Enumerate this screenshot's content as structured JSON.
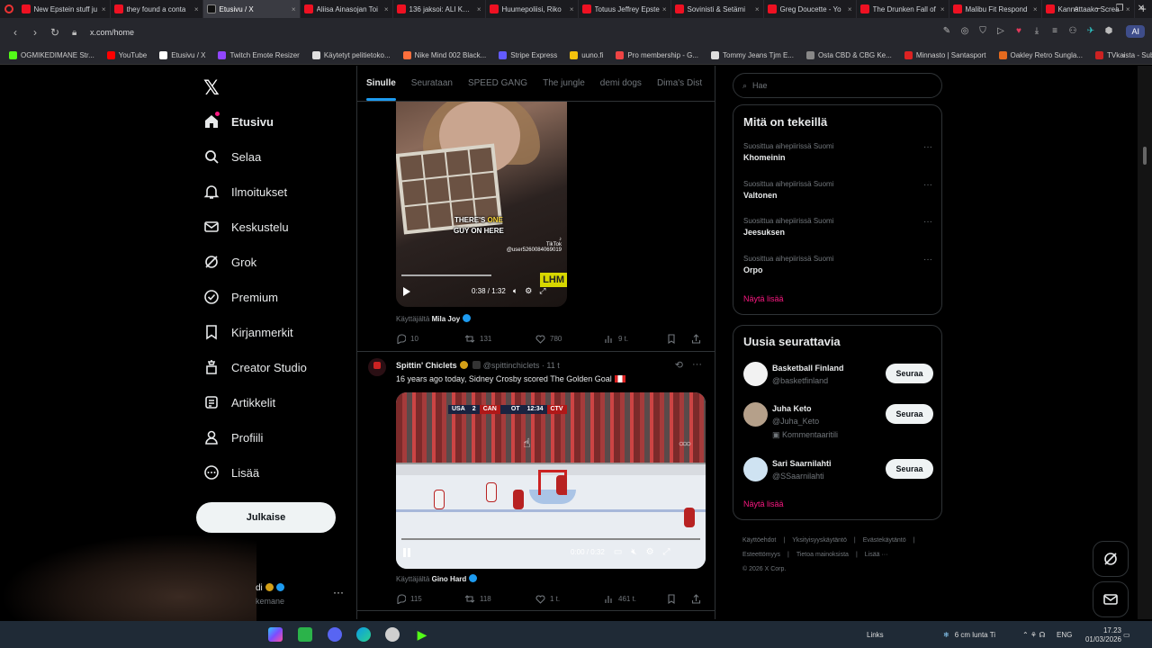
{
  "browser": {
    "tabs": [
      {
        "title": "New Epstein stuff ju",
        "favicon": "youtube-icon"
      },
      {
        "title": "they found a conta",
        "favicon": "youtube-icon"
      },
      {
        "title": "Etusivu / X",
        "favicon": "x-icon",
        "active": true
      },
      {
        "title": "Aliisa Ainasojan Toi",
        "favicon": "youtube-icon"
      },
      {
        "title": "136 jaksoi: ALI KHAN",
        "favicon": "youtube-icon"
      },
      {
        "title": "Huumepoliisi, Riko",
        "favicon": "youtube-icon"
      },
      {
        "title": "Totuus Jeffrey Epste",
        "favicon": "youtube-icon"
      },
      {
        "title": "Sovinisti & Setämi",
        "favicon": "youtube-icon"
      },
      {
        "title": "Greg Doucette - Yo",
        "favicon": "youtube-icon"
      },
      {
        "title": "The Drunken Fall of",
        "favicon": "youtube-icon"
      },
      {
        "title": "Malibu Fit Respond",
        "favicon": "youtube-icon"
      },
      {
        "title": "Kannattaako Screa",
        "favicon": "youtube-icon"
      }
    ],
    "url": "x.com/home",
    "ai_label": "AI",
    "bookmarks": [
      {
        "label": "OGMIKEDIMANE Str...",
        "color": "#53fc18"
      },
      {
        "label": "YouTube",
        "color": "#ff0000"
      },
      {
        "label": "Etusivu / X",
        "color": "#ffffff"
      },
      {
        "label": "Twitch Emote Resizer",
        "color": "#9146ff"
      },
      {
        "label": "Käytetyt pelitietoko...",
        "color": "#e0e0e0"
      },
      {
        "label": "Nike Mind 002 Black...",
        "color": "#ff6f3c"
      },
      {
        "label": "Stripe Express",
        "color": "#635bff"
      },
      {
        "label": "uuno.fi",
        "color": "#f4c20d"
      },
      {
        "label": "Pro membership - G...",
        "color": "#e44"
      },
      {
        "label": "Tommy Jeans Tjm E...",
        "color": "#ddd"
      },
      {
        "label": "Osta CBD & CBG Ke...",
        "color": "#888"
      },
      {
        "label": "Minnasto | Santasport",
        "color": "#d22"
      },
      {
        "label": "Oakley Retro Sungla...",
        "color": "#e46a1e"
      },
      {
        "label": "TVkaista - Sub Suara",
        "color": "#c22"
      }
    ]
  },
  "nav": {
    "items": [
      {
        "label": "Etusivu",
        "icon": "home-icon"
      },
      {
        "label": "Selaa",
        "icon": "search-icon"
      },
      {
        "label": "Ilmoitukset",
        "icon": "bell-icon"
      },
      {
        "label": "Keskustelu",
        "icon": "mail-icon"
      },
      {
        "label": "Grok",
        "icon": "grok-icon"
      },
      {
        "label": "Premium",
        "icon": "premium-icon"
      },
      {
        "label": "Kirjanmerkit",
        "icon": "bookmark-icon"
      },
      {
        "label": "Creator Studio",
        "icon": "creator-icon"
      },
      {
        "label": "Artikkelit",
        "icon": "article-icon"
      },
      {
        "label": "Profiili",
        "icon": "profile-icon"
      },
      {
        "label": "Lisää",
        "icon": "more-icon"
      }
    ],
    "post_button": "Julkaise",
    "account_name": "di",
    "account_handle": "kemane"
  },
  "feed": {
    "tabs": [
      "Sinulle",
      "Seurataan",
      "SPEED GANG",
      "The jungle",
      "demi dogs",
      "Dima's Dist"
    ],
    "post1": {
      "caption_line1_pre": "THERE'S ",
      "caption_line1_hl": "ONE",
      "caption_line2": "GUY ON HERE",
      "tiktok": "TikTok",
      "tiktok_user": "@user5260084069019",
      "badge": "LHM",
      "video_time": "0:38 / 1:32",
      "byline_prefix": "Käyttäjältä",
      "byline_name": "Mila Joy",
      "replies": "10",
      "reposts": "131",
      "likes": "780",
      "views": "9 t."
    },
    "post2": {
      "author": "Spittin' Chiclets",
      "handle": "@spittinchiclets",
      "time": "· 11 t",
      "text": "16 years ago today, Sidney Crosby scored The Golden Goal",
      "score_usa": "USA",
      "score_usa_val": "2",
      "score_can": "CAN",
      "score_can_val": "",
      "period": "OT",
      "clock": "12:34",
      "network": "CTV",
      "video_time": "0:00 / 0:32",
      "byline_prefix": "Käyttäjältä",
      "byline_name": "Gino Hard",
      "replies": "115",
      "reposts": "118",
      "likes": "1 t.",
      "views": "461 t."
    }
  },
  "sidebar": {
    "search_placeholder": "Hae",
    "trends_title": "Mitä on tekeillä",
    "trends": [
      {
        "context": "Suosittua aihepiirissä Suomi",
        "name": "Khomeinin"
      },
      {
        "context": "Suosittua aihepiirissä Suomi",
        "name": "Valtonen"
      },
      {
        "context": "Suosittua aihepiirissä Suomi",
        "name": "Jeesuksen"
      },
      {
        "context": "Suosittua aihepiirissä Suomi",
        "name": "Orpo"
      }
    ],
    "show_more": "Näytä lisää",
    "follow_title": "Uusia seurattavia",
    "follow": [
      {
        "name": "Basketball Finland",
        "handle": "@basketfinland",
        "extra": "",
        "button": "Seuraa"
      },
      {
        "name": "Juha Keto",
        "handle": "@Juha_Keto",
        "extra": "Kommentaaritili",
        "button": "Seuraa"
      },
      {
        "name": "Sari Saarnilahti",
        "handle": "@SSaarnilahti",
        "extra": "",
        "button": "Seuraa"
      }
    ],
    "show_more2": "Näytä lisää",
    "footer": [
      "Käyttöehdot",
      "|",
      "Yksityisyyskäytäntö",
      "|",
      "Evästekäytäntö",
      "|",
      "Esteettömyys",
      "|",
      "Tietoa mainoksista",
      "|",
      "Lisää ···",
      "© 2026 X Corp."
    ]
  },
  "taskbar": {
    "links": "Links",
    "weather": "6 cm lunta Ti",
    "lang": "ENG",
    "time": "17.23",
    "date": "01/03/2026"
  }
}
